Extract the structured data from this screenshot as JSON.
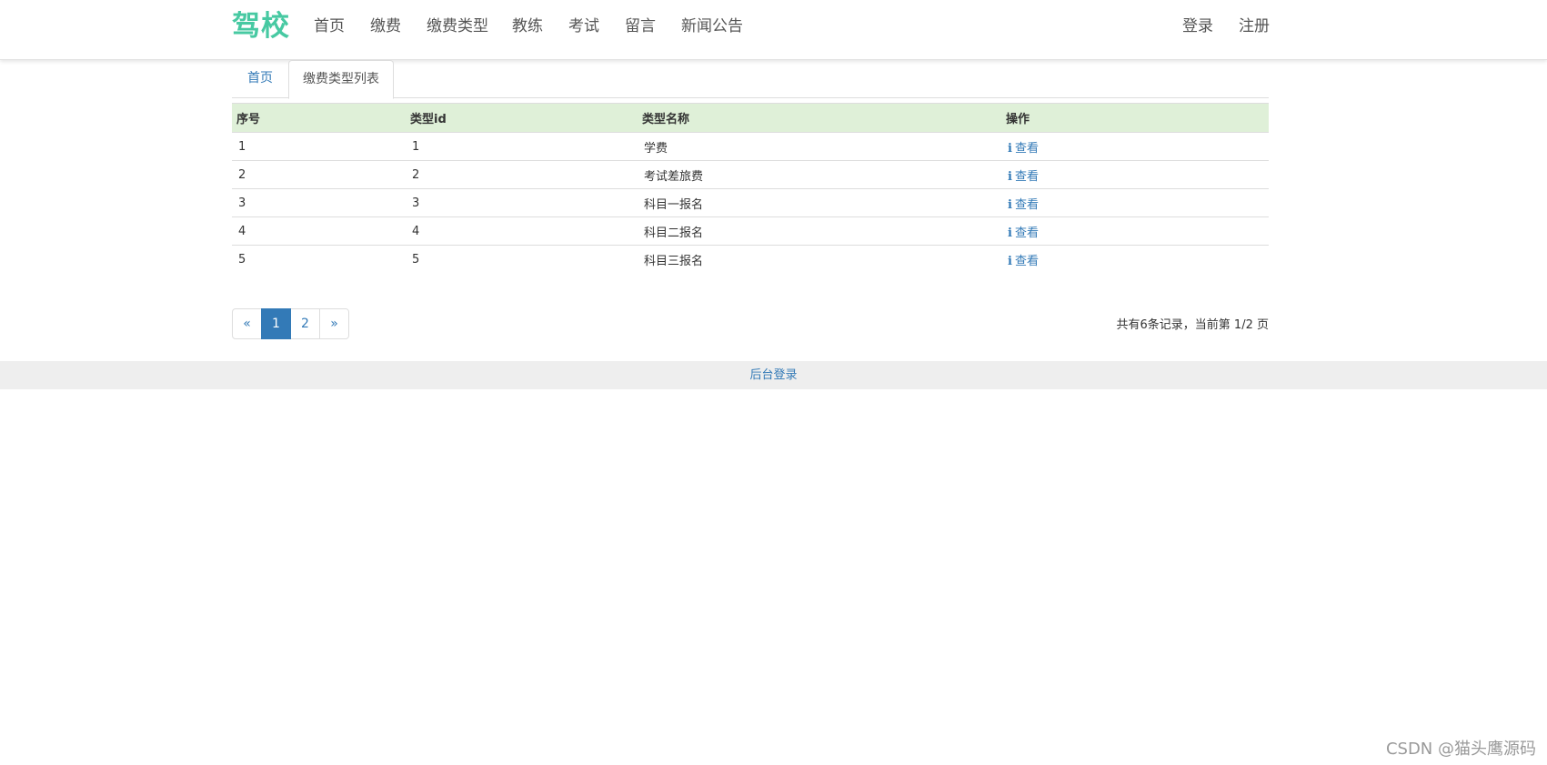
{
  "navbar": {
    "brand": "驾校",
    "links": [
      "首页",
      "缴费",
      "缴费类型",
      "教练",
      "考试",
      "留言",
      "新闻公告"
    ],
    "auth": {
      "login": "登录",
      "register": "注册"
    }
  },
  "tabs": [
    {
      "label": "首页",
      "active": false
    },
    {
      "label": "缴费类型列表",
      "active": true
    }
  ],
  "table": {
    "headers": [
      "序号",
      "类型id",
      "类型名称",
      "操作"
    ],
    "rows": [
      {
        "index": "1",
        "type_id": "1",
        "type_name": "学费",
        "action": "查看"
      },
      {
        "index": "2",
        "type_id": "2",
        "type_name": "考试差旅费",
        "action": "查看"
      },
      {
        "index": "3",
        "type_id": "3",
        "type_name": "科目一报名",
        "action": "查看"
      },
      {
        "index": "4",
        "type_id": "4",
        "type_name": "科目二报名",
        "action": "查看"
      },
      {
        "index": "5",
        "type_id": "5",
        "type_name": "科目三报名",
        "action": "查看"
      }
    ],
    "action_icon": "info-icon"
  },
  "pagination": {
    "prev": "«",
    "pages": [
      "1",
      "2"
    ],
    "current": "1",
    "next": "»",
    "record_info": "共有6条记录，当前第 1/2 页"
  },
  "footer": {
    "admin_login": "后台登录"
  },
  "watermark": "CSDN @猫头鹰源码",
  "colors": {
    "brand": "#47c9a2",
    "link": "#337ab7",
    "header_row": "#dff0d8",
    "footer_bg": "#eeeeee"
  }
}
